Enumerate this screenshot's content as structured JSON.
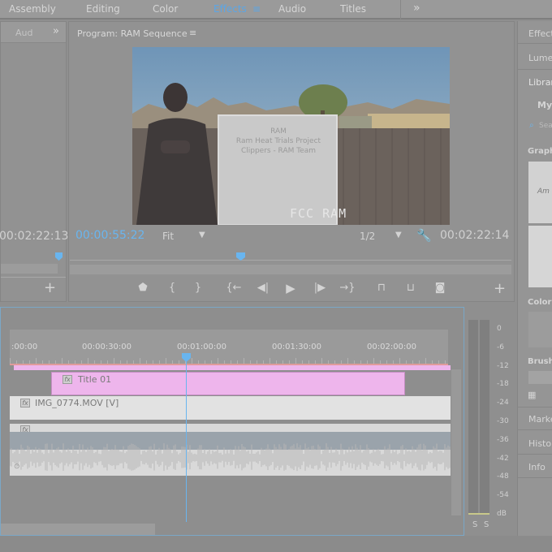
{
  "workspaces": {
    "tabs": [
      "Assembly",
      "Editing",
      "Color",
      "Effects",
      "Audio",
      "Titles"
    ],
    "active": "Effects",
    "menu_icon": "≡",
    "overflow_icon": "»"
  },
  "source_panel": {
    "tab": "Aud",
    "overflow": "»",
    "timecode": "00:02:22:13"
  },
  "program": {
    "title": "Program: RAM Sequence",
    "menu_icon": "≡",
    "video_caption": "FCC RAM",
    "whiteboard_lines": [
      "RAM",
      "Ram Heat Trials Project",
      "Clippers - RAM Team"
    ],
    "current_timecode": "00:00:55:22",
    "fit": "Fit",
    "resolution": "1/2",
    "duration_timecode": "00:02:22:14",
    "add_button": "+"
  },
  "transport": {
    "marker": "marker-icon",
    "in": "{",
    "out": "}",
    "go_in": "{←",
    "step_back": "◀|",
    "play": "▶",
    "step_fwd": "|▶",
    "go_out": "→}",
    "lift": "lift-icon",
    "extract": "extract-icon",
    "export_frame": "camera-icon"
  },
  "timeline": {
    "ruler_labels": [
      ":00:00",
      "00:00:30:00",
      "00:01:00:00",
      "00:01:30:00",
      "00:02:00:00"
    ],
    "title_clip": "Title 01",
    "video_clip": "IMG_0774.MOV [V]",
    "fx_label": "fx",
    "audio_tag": "⊙"
  },
  "meters": {
    "scale": [
      "0",
      "-6",
      "-12",
      "-18",
      "-24",
      "-30",
      "-36",
      "-42",
      "-48",
      "-54",
      "dB"
    ],
    "solo_left": "S",
    "solo_right": "S"
  },
  "right_panel": {
    "items": [
      "Effect",
      "Lumet",
      "Librar"
    ],
    "library_sel": "My",
    "search_placeholder": "Sea",
    "graphics_label": "Graphi",
    "colors_label": "Colors",
    "brushes_label": "Brushe",
    "bottom_items": [
      "Marke",
      "Histor",
      "Info"
    ]
  },
  "colors": {
    "accent": "#69b5ef",
    "title_clip": "#eeb5ec",
    "selection": "#7aa7c7"
  }
}
